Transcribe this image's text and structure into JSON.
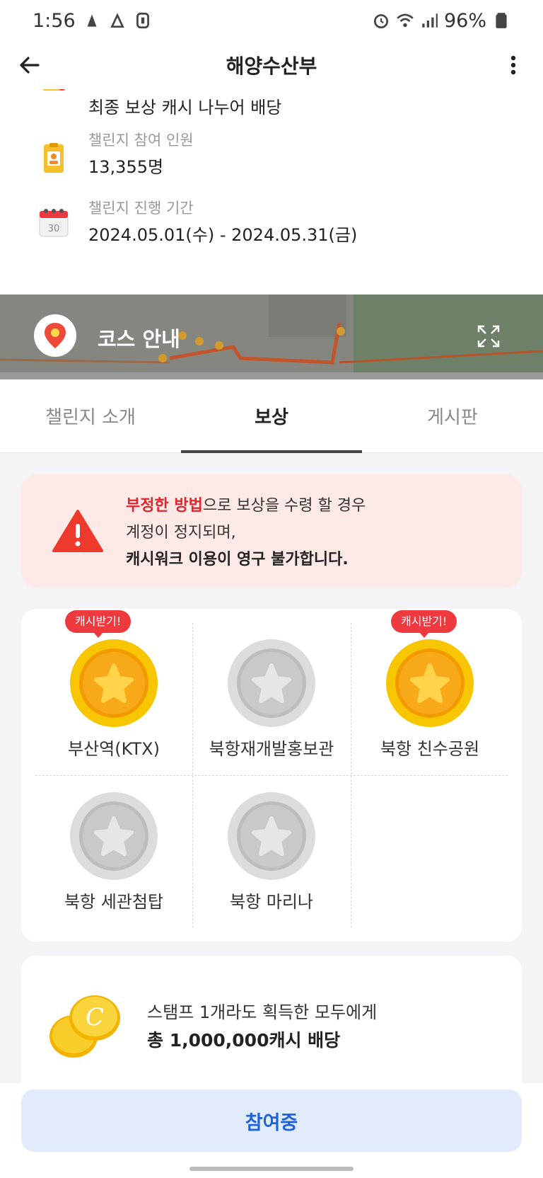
{
  "status_bar": {
    "time": "1:56",
    "battery": "96%"
  },
  "app_bar": {
    "title": "해양수산부"
  },
  "info": {
    "reward_method": "최종 보상 캐시 나누어 배당",
    "participants_label": "챌린지 참여 인원",
    "participants_value": "13,355명",
    "period_label": "챌린지 진행 기간",
    "period_value": "2024.05.01(수) - 2024.05.31(금)",
    "calendar_day": "30"
  },
  "course": {
    "label": "코스 안내"
  },
  "tabs": [
    {
      "label": "챌린지 소개",
      "active": false
    },
    {
      "label": "보상",
      "active": true
    },
    {
      "label": "게시판",
      "active": false
    }
  ],
  "warning": {
    "red_text": "부정한 방법",
    "text1_rest": "으로 보상을 수령 할 경우",
    "text2": "계정이 정지되며,",
    "text3": "캐시워크 이용이 영구 불가합니다."
  },
  "stamps": [
    {
      "name": "부산역(KTX)",
      "earned": true,
      "badge": "캐시받기!"
    },
    {
      "name": "북항재개발홍보관",
      "earned": false,
      "badge": ""
    },
    {
      "name": "북항 친수공원",
      "earned": true,
      "badge": "캐시받기!"
    },
    {
      "name": "북항 세관첨탑",
      "earned": false,
      "badge": ""
    },
    {
      "name": "북항 마리나",
      "earned": false,
      "badge": ""
    }
  ],
  "reward": {
    "line1": "스탬프 1개라도 획득한 모두에게",
    "line2": "총 1,000,000캐시 배당"
  },
  "join_button": {
    "label": "참여중"
  },
  "colors": {
    "accent_red": "#e1262d",
    "badge_red": "#ee3a3f",
    "join_blue": "#1f63d8",
    "join_bg": "#e2ebfb",
    "coin_gold": "#f5b800"
  }
}
